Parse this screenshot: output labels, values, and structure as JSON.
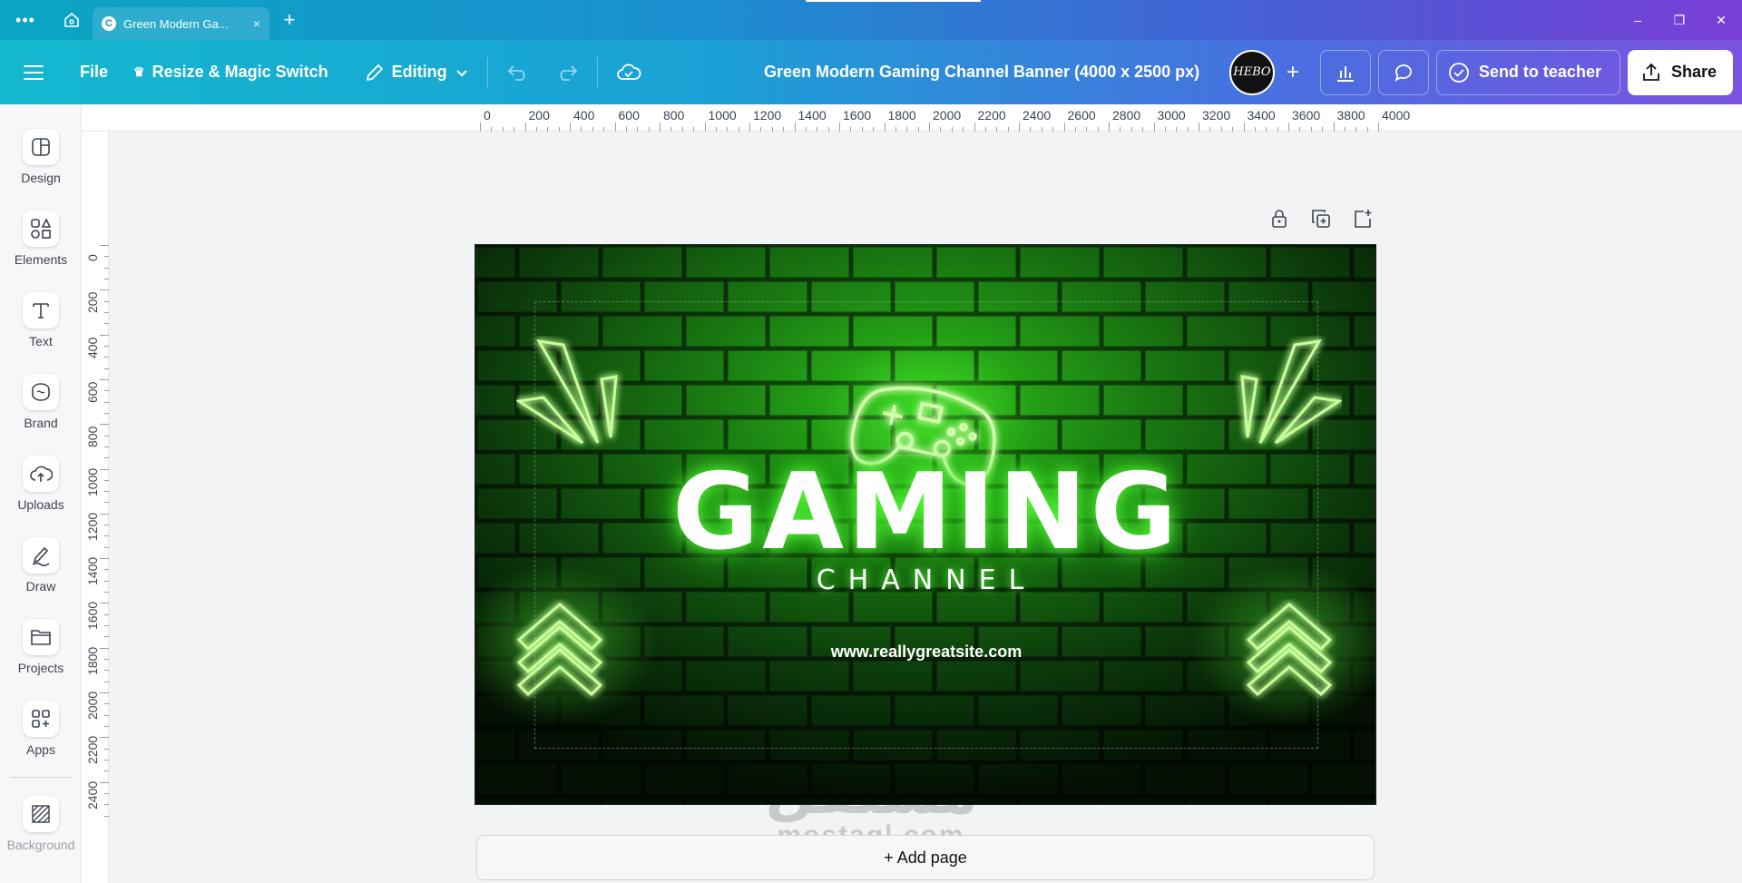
{
  "titlebar": {
    "tab_label": "Green Modern Ga...",
    "tab_favicon": "C",
    "tab_close": "×",
    "new_tab": "+",
    "window_controls": [
      "–",
      "❐",
      "✕"
    ]
  },
  "toolbar": {
    "file_label": "File",
    "resize_label": "Resize & Magic Switch",
    "editing_label": "Editing",
    "doc_title": "Green Modern Gaming Channel Banner (4000 x 2500 px)",
    "avatar_text": "HEBO",
    "teacher_label": "Send to teacher",
    "share_label": "Share"
  },
  "sidebar": {
    "items": [
      {
        "label": "Design",
        "icon": "design-icon"
      },
      {
        "label": "Elements",
        "icon": "elements-icon"
      },
      {
        "label": "Text",
        "icon": "text-icon"
      },
      {
        "label": "Brand",
        "icon": "brand-icon"
      },
      {
        "label": "Uploads",
        "icon": "uploads-icon"
      },
      {
        "label": "Draw",
        "icon": "draw-icon"
      },
      {
        "label": "Projects",
        "icon": "projects-icon"
      },
      {
        "label": "Apps",
        "icon": "apps-icon"
      },
      {
        "label": "Background",
        "icon": "background-icon"
      }
    ]
  },
  "ruler": {
    "top": [
      "0",
      "200",
      "400",
      "600",
      "800",
      "1000",
      "1200",
      "1400",
      "1600",
      "1800",
      "2000",
      "2200",
      "2400",
      "2600",
      "2800",
      "3000",
      "3200",
      "3400",
      "3600",
      "3800",
      "4000"
    ],
    "left": [
      "0",
      "200",
      "400",
      "600",
      "800",
      "1000",
      "1200",
      "1400",
      "1600",
      "1800",
      "2000",
      "2200",
      "2400"
    ]
  },
  "banner": {
    "title": "GAMING",
    "subtitle": "CHANNEL",
    "url": "www.reallygreatsite.com",
    "neon_color": "#5cff3a"
  },
  "canvas": {
    "add_page_label": "+ Add page"
  },
  "watermark": {
    "arabic": "مستقل",
    "latin": "mostaql.com"
  }
}
